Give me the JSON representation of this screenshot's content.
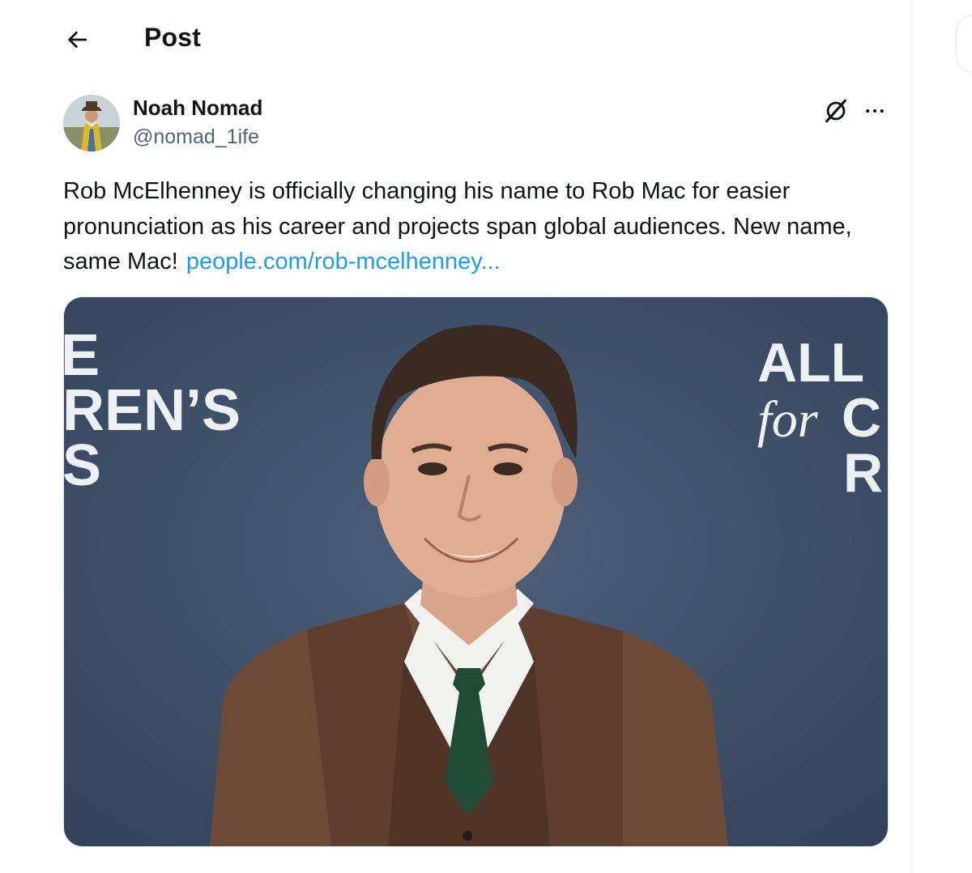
{
  "header": {
    "title": "Post",
    "back_icon": "arrow-left-icon"
  },
  "post": {
    "author": {
      "display_name": "Noah Nomad",
      "handle": "@nomad_1ife",
      "avatar_icon": "avatar-image"
    },
    "text": "Rob McElhenney is officially changing his name to Rob Mac for easier pronunciation as his career and projects span global audiences. New name, same Mac!",
    "link_text": "people.com/rob-mcelhenney...",
    "actions": {
      "grok_icon": "grok-icon",
      "more_icon": "more-icon"
    },
    "media": {
      "backdrop_text_left": [
        "E",
        "REN’S",
        "’S"
      ],
      "backdrop_text_right": [
        "ALL",
        "for",
        "C",
        "R"
      ]
    }
  },
  "colors": {
    "link": "#1d9bf0",
    "secondary_text": "#536471",
    "primary_text": "#0f1419",
    "backdrop": "#3d4e66"
  }
}
